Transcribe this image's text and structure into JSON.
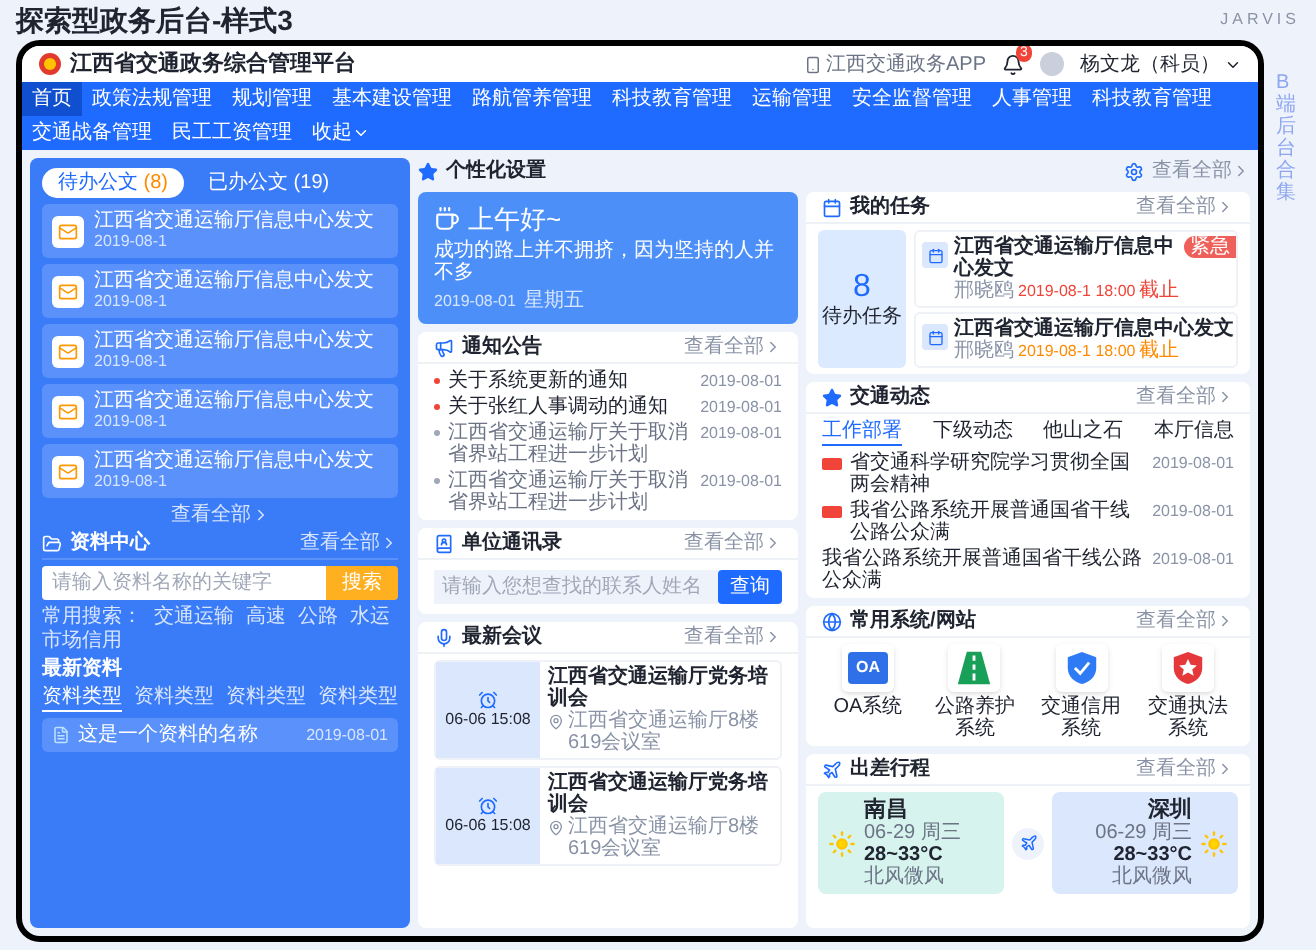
{
  "page_title": "探索型政务后台-样式3",
  "side_caption": "B端后台合集",
  "brand_mark": "JARVIS",
  "app": {
    "title": "江西省交通政务综合管理平台",
    "app_link": "江西交通政务APP",
    "notifications": "3",
    "user": "杨文龙（科员）"
  },
  "nav": [
    {
      "label": "首页",
      "selected": true
    },
    {
      "label": "政策法规管理",
      "selected": false
    },
    {
      "label": "规划管理",
      "selected": false
    },
    {
      "label": "基本建设管理",
      "selected": false
    },
    {
      "label": "路航管养管理",
      "selected": false
    },
    {
      "label": "科技教育管理",
      "selected": false
    },
    {
      "label": "运输管理",
      "selected": false
    },
    {
      "label": "安全监督管理",
      "selected": false
    },
    {
      "label": "人事管理",
      "selected": false
    },
    {
      "label": "科技教育管理",
      "selected": false
    },
    {
      "label": "交通战备管理",
      "selected": false
    },
    {
      "label": "民工工资管理",
      "selected": false
    }
  ],
  "nav_toggle": "收起",
  "docs": {
    "tabs": [
      {
        "label": "待办公文",
        "count": "(8)",
        "selected": true
      },
      {
        "label": "已办公文",
        "count": "(19)",
        "selected": false
      }
    ],
    "items": [
      {
        "title": "江西省交通运输厅信息中心发文",
        "date": "2019-08-1"
      },
      {
        "title": "江西省交通运输厅信息中心发文",
        "date": "2019-08-1"
      },
      {
        "title": "江西省交通运输厅信息中心发文",
        "date": "2019-08-1"
      },
      {
        "title": "江西省交通运输厅信息中心发文",
        "date": "2019-08-1"
      },
      {
        "title": "江西省交通运输厅信息中心发文",
        "date": "2019-08-1"
      }
    ],
    "more": "查看全部"
  },
  "resources": {
    "title": "资料中心",
    "more": "查看全部",
    "search_placeholder": "请输入资料名称的关键字",
    "search_button": "搜索",
    "hot_label": "常用搜索：",
    "hot": [
      "交通运输",
      "高速",
      "公路",
      "水运",
      "市场信用"
    ],
    "latest_title": "最新资料",
    "tabs": [
      {
        "label": "资料类型",
        "selected": true
      },
      {
        "label": "资料类型",
        "selected": false
      },
      {
        "label": "资料类型",
        "selected": false
      },
      {
        "label": "资料类型",
        "selected": false
      }
    ],
    "items": [
      {
        "name": "这是一个资料的名称",
        "date": "2019-08-01"
      }
    ]
  },
  "personal": {
    "title": "个性化设置",
    "more": "查看全部",
    "greeting": "上午好~",
    "motto": "成功的路上并不拥挤，因为坚持的人并不多",
    "date": "2019-08-01",
    "weekday": "星期五"
  },
  "tasks": {
    "title": "我的任务",
    "more": "查看全部",
    "count": "8",
    "count_label": "待办任务",
    "items": [
      {
        "title": "江西省交通运输厅信息中心发文",
        "sender": "邢晓鸥",
        "deadline": "2019-08-1 18:00",
        "deadline_suffix": "截止",
        "urgent": true,
        "urgent_label": "紧急"
      },
      {
        "title": "江西省交通运输厅信息中心发文",
        "sender": "邢晓鸥",
        "deadline": "2019-08-1 18:00",
        "deadline_suffix": "截止",
        "urgent": false
      }
    ]
  },
  "notices": {
    "title": "通知公告",
    "more": "查看全部",
    "items": [
      {
        "title": "关于系统更新的通知",
        "date": "2019-08-01",
        "important": true
      },
      {
        "title": "关于张红人事调动的通知",
        "date": "2019-08-01",
        "important": true
      },
      {
        "title": "江西省交通运输厅关于取消省界站工程进一步计划",
        "date": "2019-08-01",
        "important": false
      },
      {
        "title": "江西省交通运输厅关于取消省界站工程进一步计划",
        "date": "2019-08-01",
        "important": false
      }
    ]
  },
  "traffic": {
    "title": "交通动态",
    "more": "查看全部",
    "tabs": [
      {
        "label": "工作部署",
        "selected": true
      },
      {
        "label": "下级动态",
        "selected": false
      },
      {
        "label": "他山之石",
        "selected": false
      },
      {
        "label": "本厅信息",
        "selected": false
      }
    ],
    "items": [
      {
        "title": "省交通科学研究院学习贯彻全国两会精神",
        "date": "2019-08-01",
        "hot": true
      },
      {
        "title": "我省公路系统开展普通国省干线公路公众满",
        "date": "2019-08-01",
        "hot": true
      },
      {
        "title": "我省公路系统开展普通国省干线公路公众满",
        "date": "2019-08-01",
        "hot": false
      }
    ]
  },
  "contacts": {
    "title": "单位通讯录",
    "more": "查看全部",
    "placeholder": "请输入您想查找的联系人姓名",
    "button": "查询"
  },
  "systems": {
    "title": "常用系统/网站",
    "more": "查看全部",
    "items": [
      {
        "label": "OA系统",
        "kind": "oa",
        "icon_text": "OA"
      },
      {
        "label": "公路养护系统",
        "kind": "road"
      },
      {
        "label": "交通信用系统",
        "kind": "credit"
      },
      {
        "label": "交通执法系统",
        "kind": "law"
      }
    ]
  },
  "meetings": {
    "title": "最新会议",
    "more": "查看全部",
    "items": [
      {
        "time": "06-06 15:08",
        "title": "江西省交通运输厅党务培训会",
        "place": "江西省交通运输厅8楼619会议室"
      },
      {
        "time": "06-06 15:08",
        "title": "江西省交通运输厅党务培训会",
        "place": "江西省交通运输厅8楼619会议室"
      }
    ]
  },
  "trip": {
    "title": "出差行程",
    "more": "查看全部",
    "from": {
      "city": "南昌",
      "date": "06-29 周三",
      "temp": "28~33°C",
      "wind": "北风微风"
    },
    "to": {
      "city": "深圳",
      "date": "06-29 周三",
      "temp": "28~33°C",
      "wind": "北风微风"
    }
  }
}
